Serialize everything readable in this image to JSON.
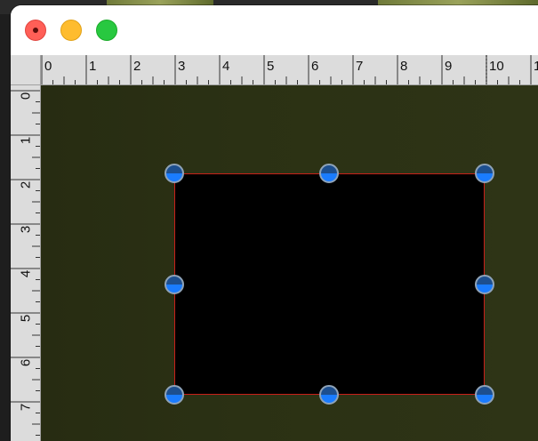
{
  "window": {
    "controls": {
      "close": "close-window",
      "minimize": "minimize-window",
      "zoom": "zoom-window"
    }
  },
  "ruler": {
    "horizontal_labels": [
      "0",
      "1",
      "2",
      "3",
      "4",
      "5",
      "6",
      "7",
      "8",
      "9",
      "10",
      "1"
    ],
    "vertical_labels": [
      "0",
      "1",
      "2",
      "3",
      "4",
      "5",
      "6",
      "7"
    ]
  },
  "colors": {
    "canvas": "#2b3114",
    "selection_fill": "#000000",
    "selection_border": "#c8201a",
    "handle_fill": "#1a7cff",
    "close": "#ff5f57",
    "minimize": "#febc2e",
    "zoom": "#28c840"
  },
  "icons": {
    "close": "close-icon",
    "minimize": "minimize-icon",
    "zoom": "zoom-icon"
  }
}
